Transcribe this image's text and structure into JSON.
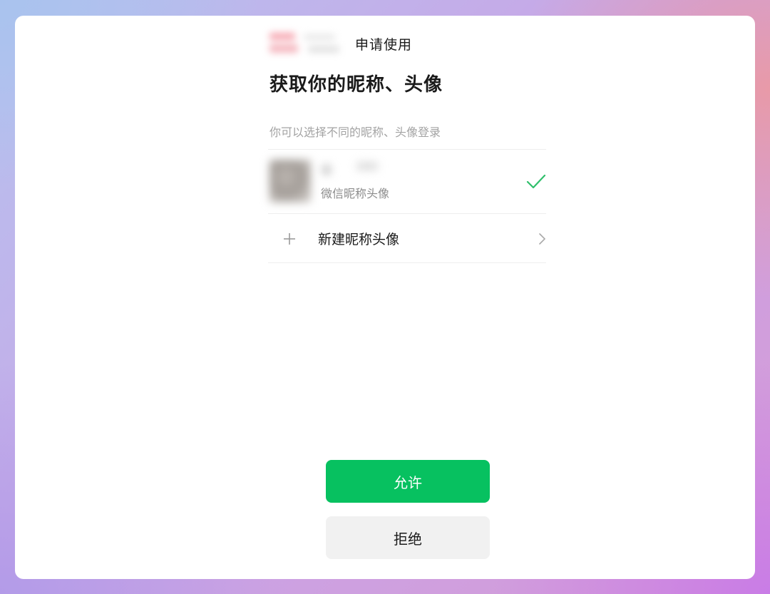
{
  "header": {
    "request_label": "申请使用",
    "app_logo_icon": "blurred-app-logo"
  },
  "main": {
    "title": "获取你的昵称、头像",
    "hint": "你可以选择不同的昵称、头像登录"
  },
  "options": [
    {
      "sublabel": "微信昵称头像",
      "selected": true,
      "avatar_icon": "blurred-user-avatar",
      "check_icon": "check-icon"
    },
    {
      "label": "新建昵称头像",
      "leading_icon": "plus-icon",
      "trailing_icon": "chevron-right-icon"
    }
  ],
  "buttons": {
    "allow_label": "允许",
    "deny_label": "拒绝"
  },
  "colors": {
    "accent": "#07c160",
    "check": "#2fbf6b",
    "deny_bg": "#f1f1f1",
    "hint_text": "#a3a3a3"
  }
}
